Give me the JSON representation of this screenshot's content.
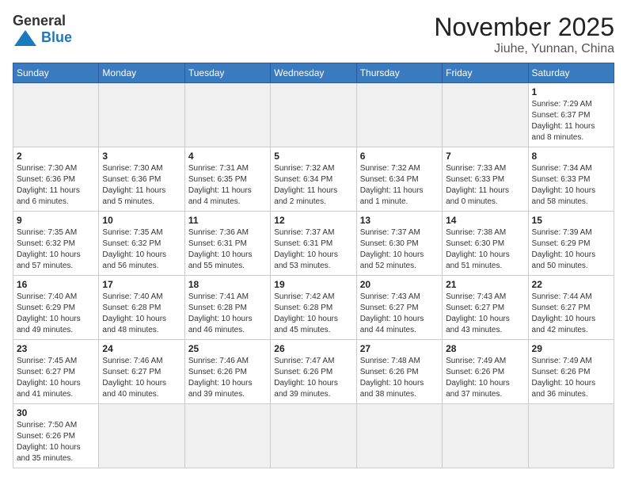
{
  "header": {
    "logo_general": "General",
    "logo_blue": "Blue",
    "title": "November 2025",
    "subtitle": "Jiuhe, Yunnan, China"
  },
  "weekdays": [
    "Sunday",
    "Monday",
    "Tuesday",
    "Wednesday",
    "Thursday",
    "Friday",
    "Saturday"
  ],
  "weeks": [
    [
      {
        "day": "",
        "info": ""
      },
      {
        "day": "",
        "info": ""
      },
      {
        "day": "",
        "info": ""
      },
      {
        "day": "",
        "info": ""
      },
      {
        "day": "",
        "info": ""
      },
      {
        "day": "",
        "info": ""
      },
      {
        "day": "1",
        "info": "Sunrise: 7:29 AM\nSunset: 6:37 PM\nDaylight: 11 hours\nand 8 minutes."
      }
    ],
    [
      {
        "day": "2",
        "info": "Sunrise: 7:30 AM\nSunset: 6:36 PM\nDaylight: 11 hours\nand 6 minutes."
      },
      {
        "day": "3",
        "info": "Sunrise: 7:30 AM\nSunset: 6:36 PM\nDaylight: 11 hours\nand 5 minutes."
      },
      {
        "day": "4",
        "info": "Sunrise: 7:31 AM\nSunset: 6:35 PM\nDaylight: 11 hours\nand 4 minutes."
      },
      {
        "day": "5",
        "info": "Sunrise: 7:32 AM\nSunset: 6:34 PM\nDaylight: 11 hours\nand 2 minutes."
      },
      {
        "day": "6",
        "info": "Sunrise: 7:32 AM\nSunset: 6:34 PM\nDaylight: 11 hours\nand 1 minute."
      },
      {
        "day": "7",
        "info": "Sunrise: 7:33 AM\nSunset: 6:33 PM\nDaylight: 11 hours\nand 0 minutes."
      },
      {
        "day": "8",
        "info": "Sunrise: 7:34 AM\nSunset: 6:33 PM\nDaylight: 10 hours\nand 58 minutes."
      }
    ],
    [
      {
        "day": "9",
        "info": "Sunrise: 7:35 AM\nSunset: 6:32 PM\nDaylight: 10 hours\nand 57 minutes."
      },
      {
        "day": "10",
        "info": "Sunrise: 7:35 AM\nSunset: 6:32 PM\nDaylight: 10 hours\nand 56 minutes."
      },
      {
        "day": "11",
        "info": "Sunrise: 7:36 AM\nSunset: 6:31 PM\nDaylight: 10 hours\nand 55 minutes."
      },
      {
        "day": "12",
        "info": "Sunrise: 7:37 AM\nSunset: 6:31 PM\nDaylight: 10 hours\nand 53 minutes."
      },
      {
        "day": "13",
        "info": "Sunrise: 7:37 AM\nSunset: 6:30 PM\nDaylight: 10 hours\nand 52 minutes."
      },
      {
        "day": "14",
        "info": "Sunrise: 7:38 AM\nSunset: 6:30 PM\nDaylight: 10 hours\nand 51 minutes."
      },
      {
        "day": "15",
        "info": "Sunrise: 7:39 AM\nSunset: 6:29 PM\nDaylight: 10 hours\nand 50 minutes."
      }
    ],
    [
      {
        "day": "16",
        "info": "Sunrise: 7:40 AM\nSunset: 6:29 PM\nDaylight: 10 hours\nand 49 minutes."
      },
      {
        "day": "17",
        "info": "Sunrise: 7:40 AM\nSunset: 6:28 PM\nDaylight: 10 hours\nand 48 minutes."
      },
      {
        "day": "18",
        "info": "Sunrise: 7:41 AM\nSunset: 6:28 PM\nDaylight: 10 hours\nand 46 minutes."
      },
      {
        "day": "19",
        "info": "Sunrise: 7:42 AM\nSunset: 6:28 PM\nDaylight: 10 hours\nand 45 minutes."
      },
      {
        "day": "20",
        "info": "Sunrise: 7:43 AM\nSunset: 6:27 PM\nDaylight: 10 hours\nand 44 minutes."
      },
      {
        "day": "21",
        "info": "Sunrise: 7:43 AM\nSunset: 6:27 PM\nDaylight: 10 hours\nand 43 minutes."
      },
      {
        "day": "22",
        "info": "Sunrise: 7:44 AM\nSunset: 6:27 PM\nDaylight: 10 hours\nand 42 minutes."
      }
    ],
    [
      {
        "day": "23",
        "info": "Sunrise: 7:45 AM\nSunset: 6:27 PM\nDaylight: 10 hours\nand 41 minutes."
      },
      {
        "day": "24",
        "info": "Sunrise: 7:46 AM\nSunset: 6:27 PM\nDaylight: 10 hours\nand 40 minutes."
      },
      {
        "day": "25",
        "info": "Sunrise: 7:46 AM\nSunset: 6:26 PM\nDaylight: 10 hours\nand 39 minutes."
      },
      {
        "day": "26",
        "info": "Sunrise: 7:47 AM\nSunset: 6:26 PM\nDaylight: 10 hours\nand 39 minutes."
      },
      {
        "day": "27",
        "info": "Sunrise: 7:48 AM\nSunset: 6:26 PM\nDaylight: 10 hours\nand 38 minutes."
      },
      {
        "day": "28",
        "info": "Sunrise: 7:49 AM\nSunset: 6:26 PM\nDaylight: 10 hours\nand 37 minutes."
      },
      {
        "day": "29",
        "info": "Sunrise: 7:49 AM\nSunset: 6:26 PM\nDaylight: 10 hours\nand 36 minutes."
      }
    ],
    [
      {
        "day": "30",
        "info": "Sunrise: 7:50 AM\nSunset: 6:26 PM\nDaylight: 10 hours\nand 35 minutes."
      },
      {
        "day": "",
        "info": ""
      },
      {
        "day": "",
        "info": ""
      },
      {
        "day": "",
        "info": ""
      },
      {
        "day": "",
        "info": ""
      },
      {
        "day": "",
        "info": ""
      },
      {
        "day": "",
        "info": ""
      }
    ]
  ]
}
